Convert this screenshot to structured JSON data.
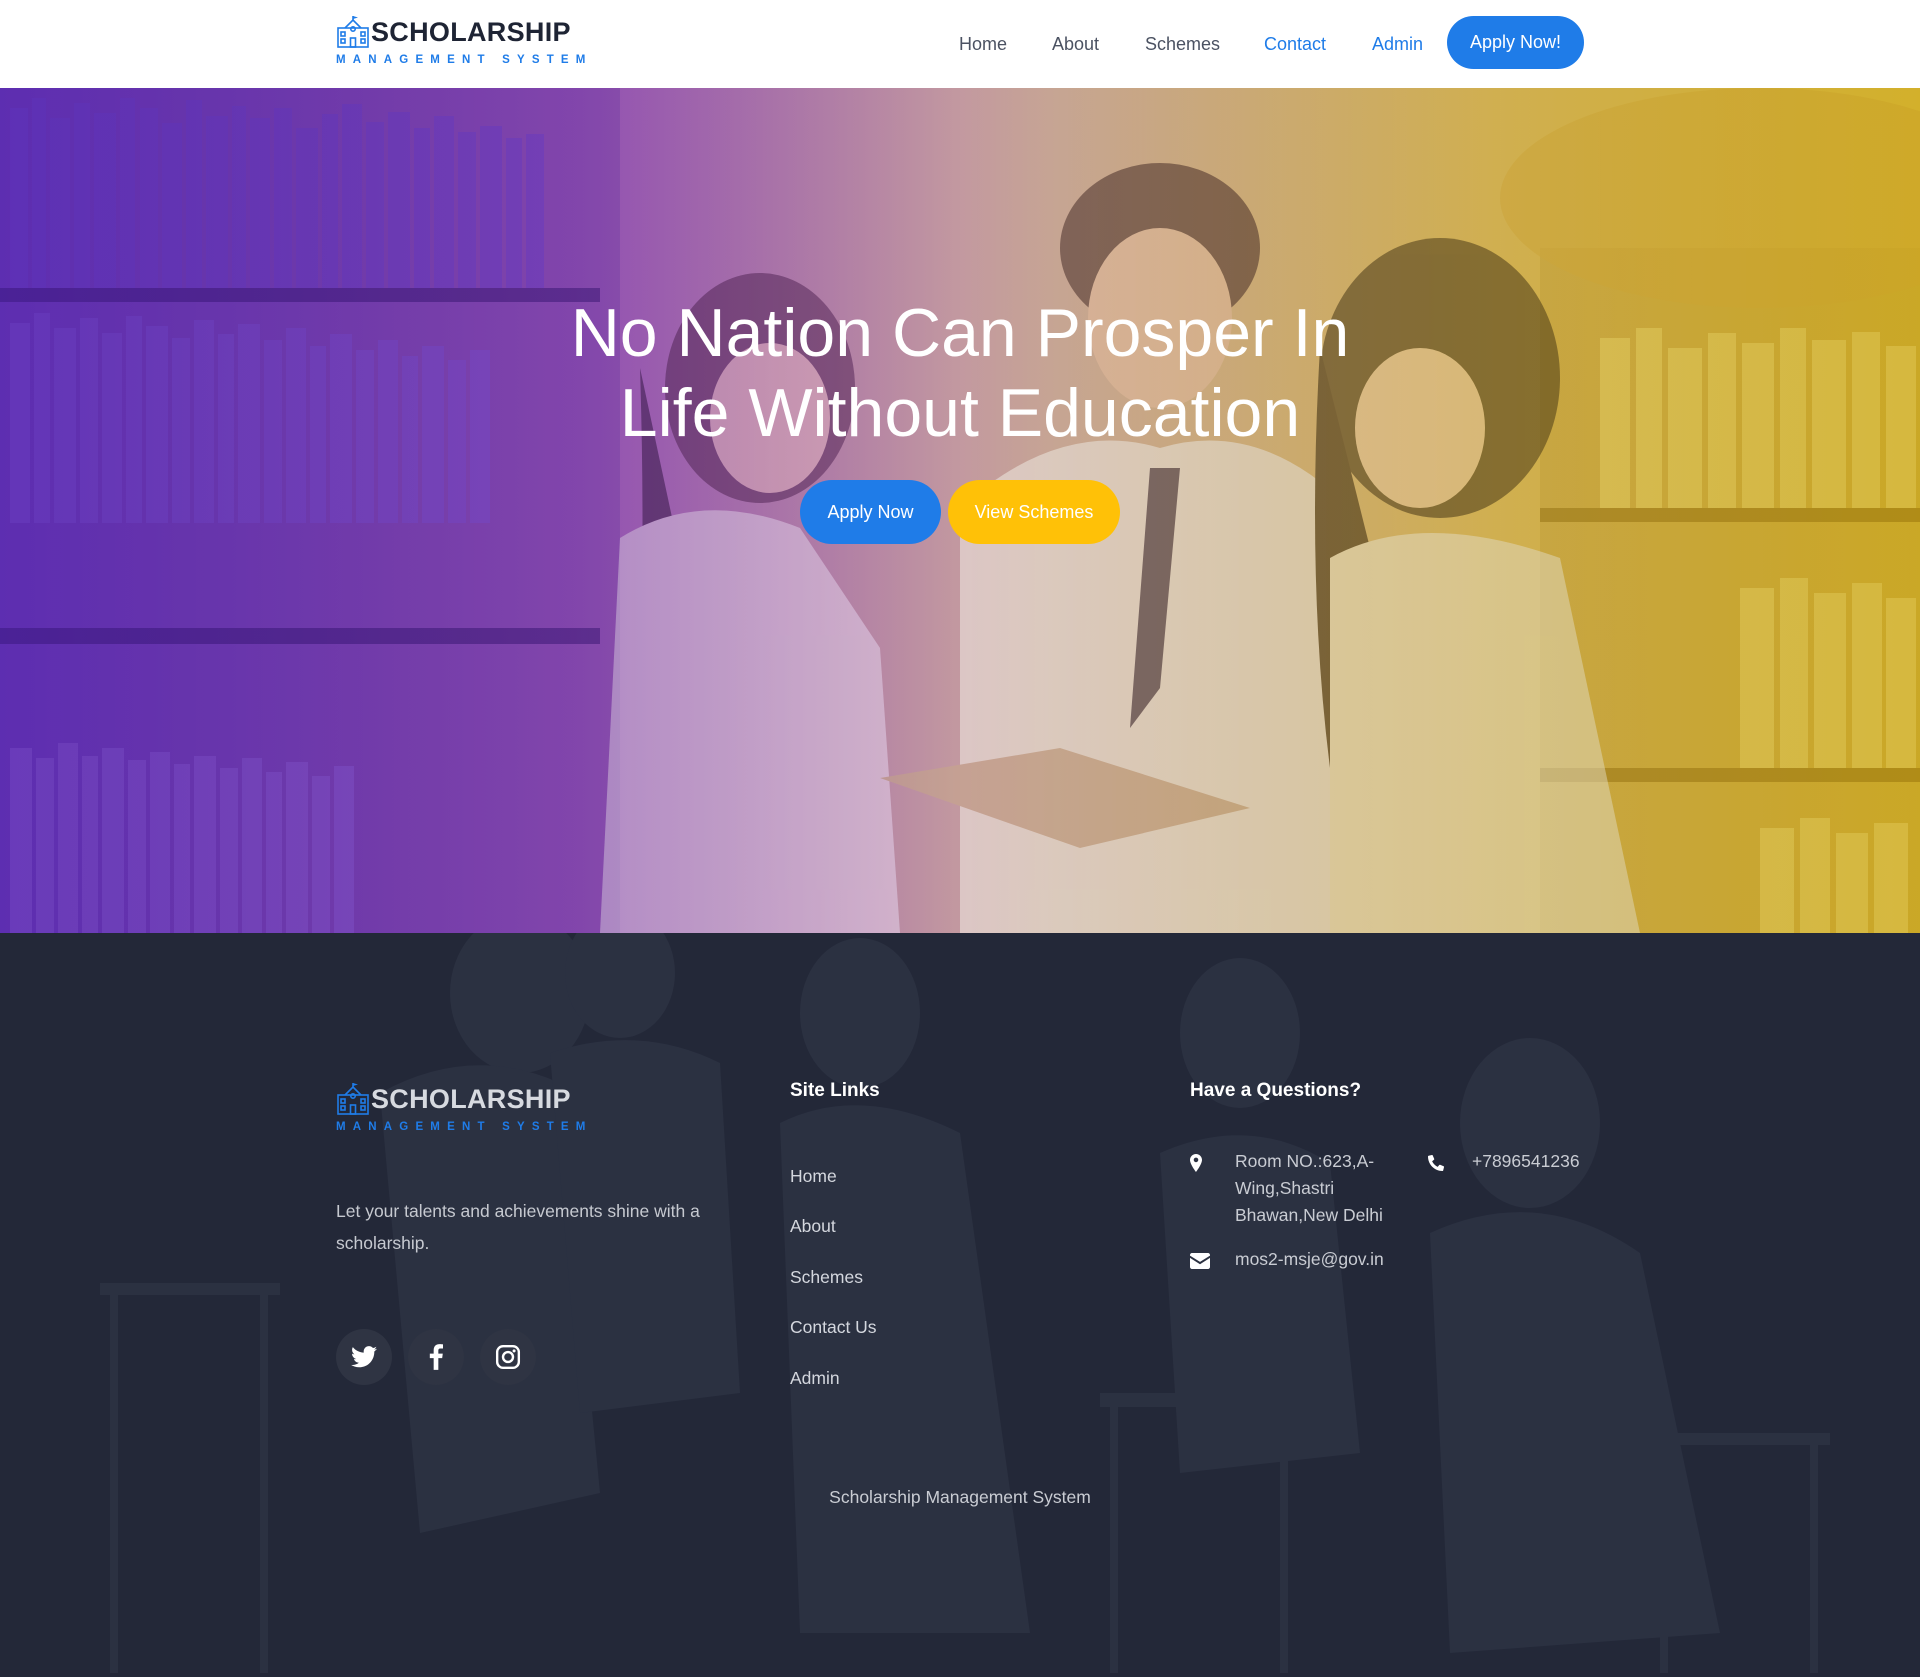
{
  "brand": {
    "title": "SCHOLARSHIP",
    "subtitle": "MANAGEMENT SYSTEM",
    "icon": "school-building-icon"
  },
  "nav": {
    "items": [
      {
        "label": "Home"
      },
      {
        "label": "About"
      },
      {
        "label": "Schemes"
      },
      {
        "label": "Contact"
      },
      {
        "label": "Admin"
      }
    ],
    "cta_label": "Apply Now!"
  },
  "hero": {
    "title_line1": "No Nation Can Prosper In",
    "title_line2": "Life Without Education",
    "apply_label": "Apply Now",
    "schemes_label": "View Schemes"
  },
  "footer": {
    "description": "Let your talents and achievements shine with a scholarship.",
    "social": [
      {
        "icon": "twitter-icon"
      },
      {
        "icon": "facebook-icon"
      },
      {
        "icon": "instagram-icon"
      }
    ],
    "site_links_heading": "Site Links",
    "site_links": [
      "Home",
      "About",
      "Schemes",
      "Contact Us",
      "Admin"
    ],
    "contact_heading": "Have a Questions?",
    "address": "Room NO.:623,A-Wing,Shastri Bhawan,New Delhi",
    "address_lines": [
      "Room NO.:623,A-",
      "Wing,Shastri",
      "Bhawan,New Delhi"
    ],
    "phone": "+7896541236",
    "email": "mos2-msje@gov.in",
    "copyright": "Scholarship Management System"
  },
  "colors": {
    "accent_blue": "#1f7ce8",
    "accent_yellow": "#ffc107",
    "footer_bg": "#232838",
    "hero_gradient_left": "#7a3fd6",
    "hero_gradient_right": "#e9c636"
  }
}
